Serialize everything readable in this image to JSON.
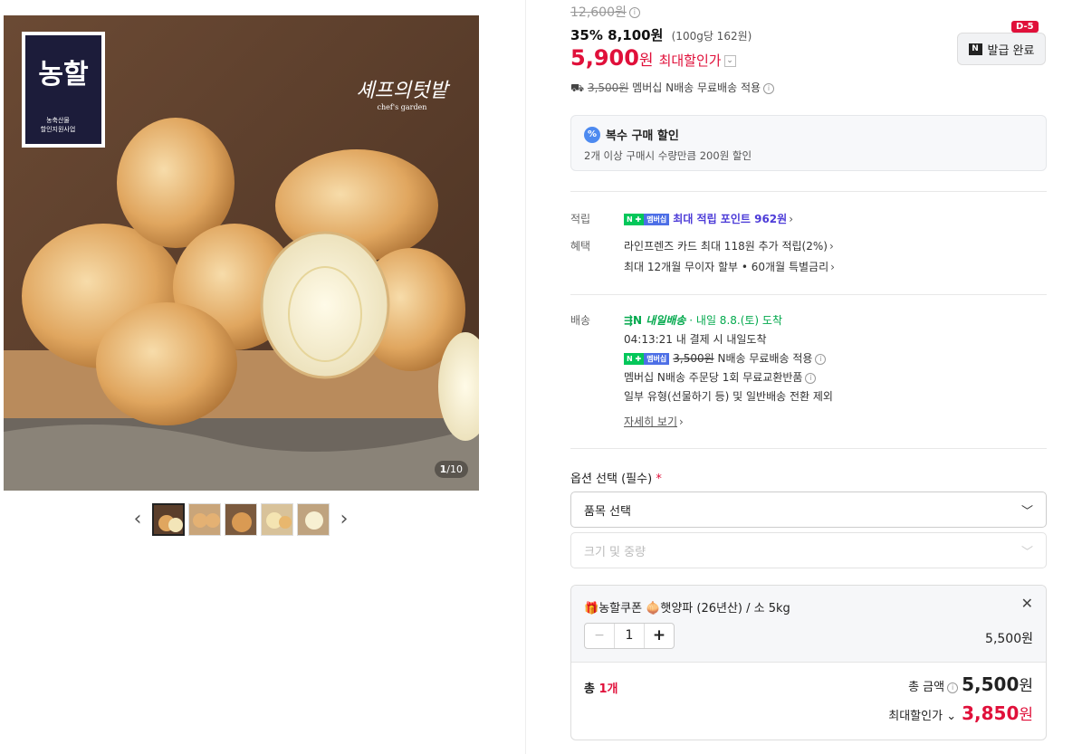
{
  "gallery": {
    "badge_text": "농할",
    "badge_sub1": "농축산물",
    "badge_sub2": "할인지원사업",
    "brand_script": "셰프의텃밭",
    "brand_en": "chef's garden",
    "counter_current": "1",
    "counter_total": "/10",
    "prev_icon": "chevron-left-icon",
    "next_icon": "chevron-right-icon"
  },
  "price": {
    "original": "12,600원",
    "discount_rate": "35%",
    "sale_price": "8,100원",
    "unit_price": "(100g당 162원)",
    "max_discount_price": "5,900",
    "won": "원",
    "max_discount_label": "최대할인가"
  },
  "coupon": {
    "dday": "D-5",
    "button_label": "발급 완료"
  },
  "shipping_summary": {
    "orig_fee": "3,500원",
    "text": "멤버십 N배송 무료배송 적용"
  },
  "multi_discount": {
    "title": "복수 구매 할인",
    "desc": "2개 이상 구매시 수량만큼 200원 할인"
  },
  "points": {
    "label": "적립",
    "membership_tag": "멤버십",
    "text": "최대 적립 포인트 962원"
  },
  "benefits": {
    "label": "혜택",
    "line1": "라인프렌즈 카드 최대 118원 추가 적립(2%)",
    "line2": "최대 12개월 무이자 할부 • 60개월 특별금리"
  },
  "delivery": {
    "label": "배송",
    "badge": "내일배송",
    "arrival": "· 내일 8.8.(토) 도착",
    "countdown": "04:13:21",
    "countdown_text": "내 결제 시 내일도착",
    "fee_orig": "3,500원",
    "fee_text": "N배송 무료배송 적용",
    "exchange": "멤버십 N배송 주문당 1회 무료교환반품",
    "note": "일부 유형(선물하기 등) 및 일반배송 전환 제외",
    "detail_link": "자세히 보기"
  },
  "options": {
    "label": "옵션 선택 (필수)",
    "required_mark": "*",
    "select1": "품목 선택",
    "select2": "크기 및 중량"
  },
  "cart": {
    "item_prefix": "농할쿠폰",
    "item_name": "햇양파 (26년산) / 소 5kg",
    "quantity": "1",
    "item_price": "5,500원",
    "total_label": "총",
    "total_count": "1개",
    "total_amount_label": "총 금액",
    "total_amount": "5,500",
    "won": "원",
    "final_label": "최대할인가",
    "final_amount": "3,850"
  },
  "colors": {
    "accent_red": "#e0103a",
    "naver_green": "#03c75a",
    "point_purple": "#4d3cd8"
  }
}
